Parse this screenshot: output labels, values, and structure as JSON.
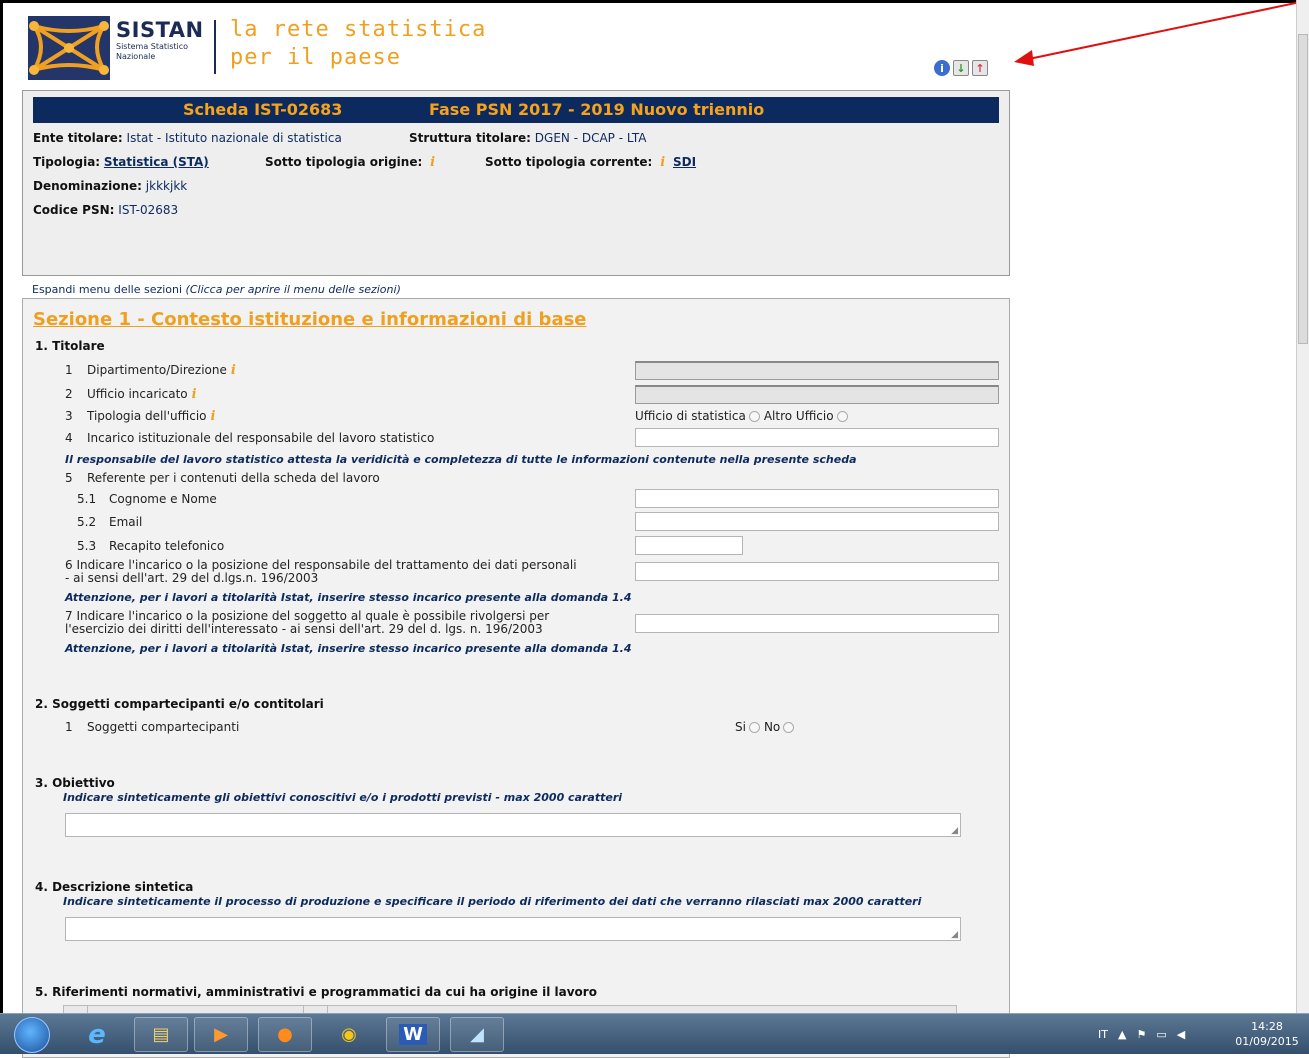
{
  "header": {
    "logo_name": "SISTAN",
    "logo_sub_1": "Sistema Statistico",
    "logo_sub_2": "Nazionale",
    "tagline_1": "la rete statistica",
    "tagline_2": "per il paese",
    "icons": [
      "info-icon",
      "download-icon",
      "pdf-icon"
    ]
  },
  "panel": {
    "scheda": "Scheda IST-02683",
    "fase": "Fase PSN 2017 - 2019 Nuovo triennio",
    "ente_label": "Ente titolare:",
    "ente_value": "Istat - Istituto nazionale di statistica",
    "struttura_label": "Struttura titolare:",
    "struttura_value": "DGEN - DCAP - LTA",
    "tipologia_label": "Tipologia:",
    "tipologia_value": "Statistica (STA)",
    "sotto_origine_label": "Sotto tipologia origine:",
    "sotto_corrente_label": "Sotto tipologia corrente:",
    "sotto_corrente_value": "SDI",
    "denominazione_label": "Denominazione:",
    "denominazione_value": "jkkkjkk",
    "codice_label": "Codice PSN:",
    "codice_value": "IST-02683"
  },
  "expand": {
    "label": "Espandi menu delle sezioni",
    "hint": "(Clicca per aprire il menu delle sezioni)"
  },
  "section1": {
    "title": "Sezione 1 - Contesto istituzione e informazioni di base",
    "titolare": {
      "heading": "1. Titolare",
      "q1": {
        "num": "1",
        "label": "Dipartimento/Direzione"
      },
      "q2": {
        "num": "2",
        "label": "Ufficio incaricato"
      },
      "q3": {
        "num": "3",
        "label": "Tipologia dell'ufficio",
        "opt1": "Ufficio di statistica",
        "opt2": "Altro Ufficio"
      },
      "q4": {
        "num": "4",
        "label": "Incarico istituzionale del responsabile del lavoro statistico"
      },
      "note1": "Il responsabile del lavoro statistico attesta la veridicità e completezza di tutte le informazioni contenute nella presente scheda",
      "q5": {
        "num": "5",
        "label": "Referente per i contenuti della scheda del lavoro"
      },
      "q51": {
        "num": "5.1",
        "label": "Cognome e Nome"
      },
      "q52": {
        "num": "5.2",
        "label": "Email"
      },
      "q53": {
        "num": "5.3",
        "label": "Recapito telefonico"
      },
      "q6_line1": "6   Indicare l'incarico o la posizione del responsabile del trattamento dei dati personali",
      "q6_line2": "- ai sensi dell'art. 29 del d.lgs.n. 196/2003",
      "note2": "Attenzione, per i lavori a titolarità Istat, inserire stesso incarico presente alla domanda 1.4",
      "q7_line1": "7   Indicare l'incarico o la posizione del soggetto al quale è possibile rivolgersi per",
      "q7_line2": "l'esercizio dei diritti dell'interessato - ai sensi dell'art. 29 del d. lgs. n. 196/2003",
      "note3": "Attenzione, per i lavori a titolarità Istat, inserire stesso incarico presente alla domanda 1.4"
    },
    "soggetti": {
      "heading": "2. Soggetti compartecipanti e/o contitolari",
      "q1": {
        "num": "1",
        "label": "Soggetti compartecipanti",
        "opt_si": "Si",
        "opt_no": "No"
      }
    },
    "obiettivo": {
      "heading": "3. Obiettivo",
      "note": "Indicare sinteticamente gli obiettivi conoscitivi e/o i prodotti previsti - max 2000 caratteri"
    },
    "descrizione": {
      "heading": "4. Descrizione sintetica",
      "note": "Indicare sinteticamente il processo di produzione e specificare il periodo di riferimento dei dati che verranno rilasciati max 2000 caratteri"
    },
    "riferimenti": {
      "heading": "5. Riferimenti normativi, amministrativi e programmatici da cui ha origine il lavoro"
    }
  },
  "taskbar": {
    "lang": "IT",
    "time": "14:28",
    "date": "01/09/2015"
  }
}
